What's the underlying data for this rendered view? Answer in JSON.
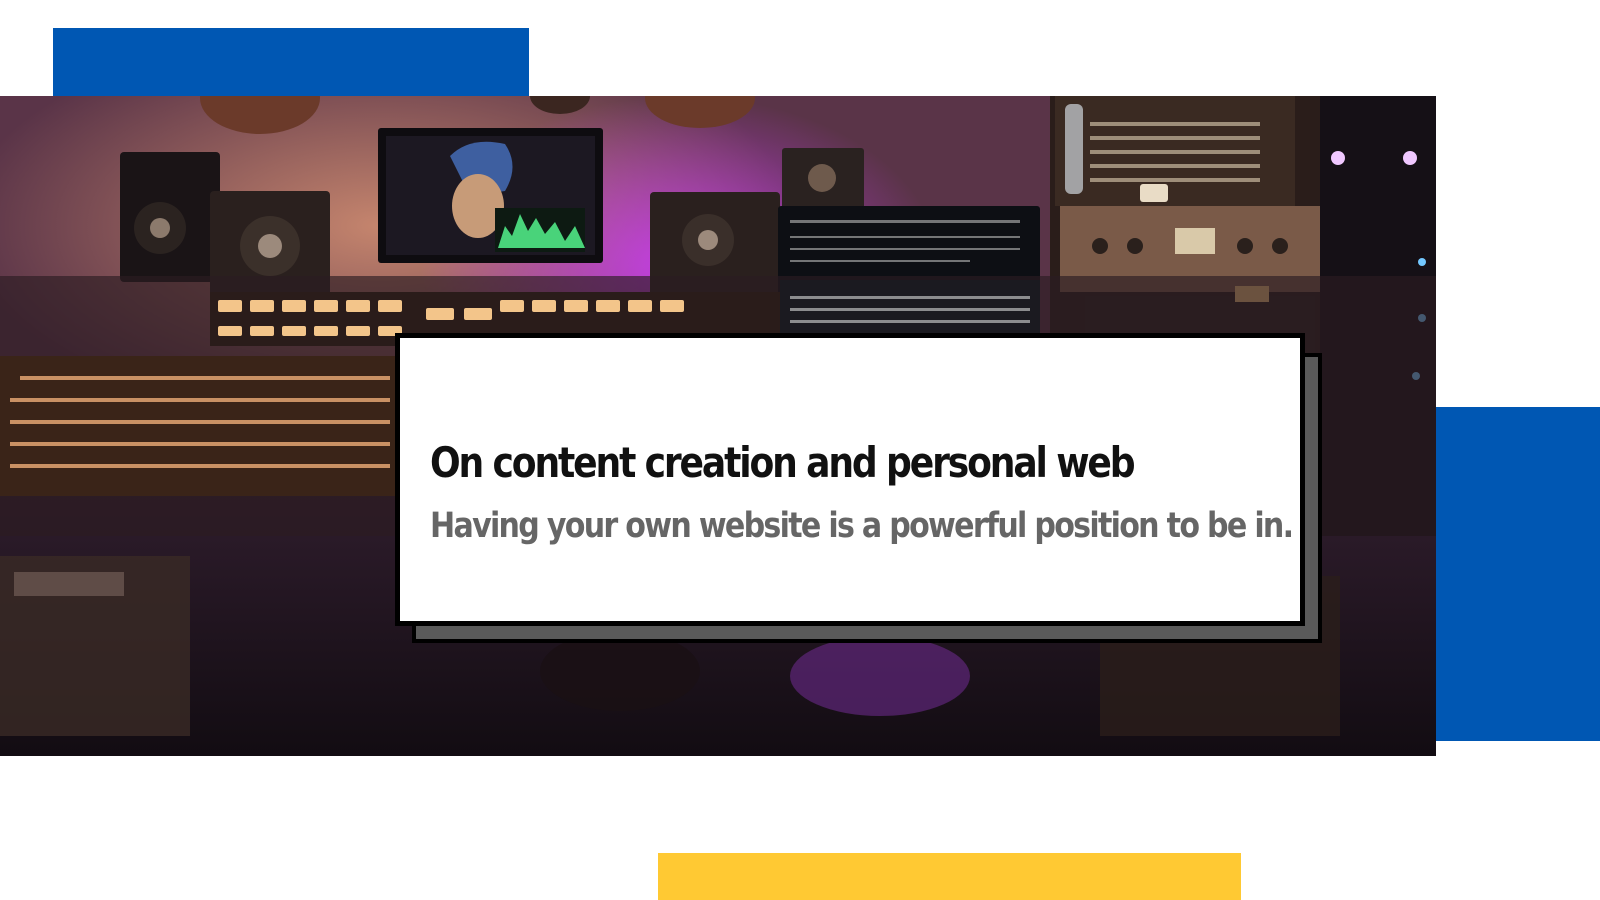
{
  "article": {
    "title": "On content creation and personal web",
    "subtitle": "Having your own website is a powerful position to be in."
  },
  "hero_image": {
    "subject": "recording-studio-photo"
  },
  "colors": {
    "accent_blue": "#0057b3",
    "accent_yellow": "#ffc933",
    "card_background": "#ffffff",
    "card_shadow": "#5a5a5a",
    "title_text": "#111111",
    "subtitle_text": "#666666"
  }
}
